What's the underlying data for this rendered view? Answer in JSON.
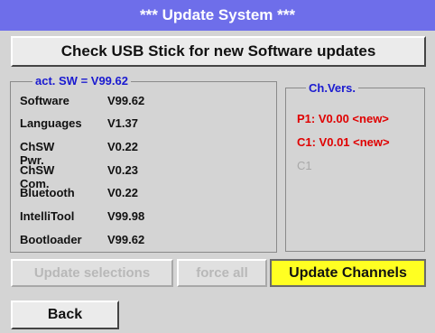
{
  "title": "***  Update System  ***",
  "check_button": "Check USB Stick for new Software updates",
  "sw_group": {
    "legend": "act. SW = V99.62",
    "rows": [
      {
        "label": "Software",
        "value": "V99.62"
      },
      {
        "label": "Languages",
        "value": "V1.37"
      },
      {
        "label": "ChSW Pwr.",
        "value": "V0.22"
      },
      {
        "label": "ChSW Com.",
        "value": "V0.23"
      },
      {
        "label": "Bluetooth",
        "value": "V0.22"
      },
      {
        "label": "IntelliTool",
        "value": "V99.98"
      },
      {
        "label": "Bootloader",
        "value": "V99.62"
      }
    ]
  },
  "ch_group": {
    "legend": "Ch.Vers.",
    "items": [
      {
        "text": "P1: V0.00 <new>",
        "color": "#e00000"
      },
      {
        "text": "C1: V0.01 <new>",
        "color": "#e00000"
      },
      {
        "text": "C1",
        "color": "#a8a8a8"
      }
    ]
  },
  "buttons": {
    "update_selections": "Update selections",
    "force_all": "force all",
    "update_channels": "Update Channels",
    "back": "Back"
  },
  "colors": {
    "title_bar": "#6e6eea",
    "legend_blue": "#1a1ad0",
    "new_red": "#e00000",
    "highlight_yellow": "#ffff22"
  }
}
